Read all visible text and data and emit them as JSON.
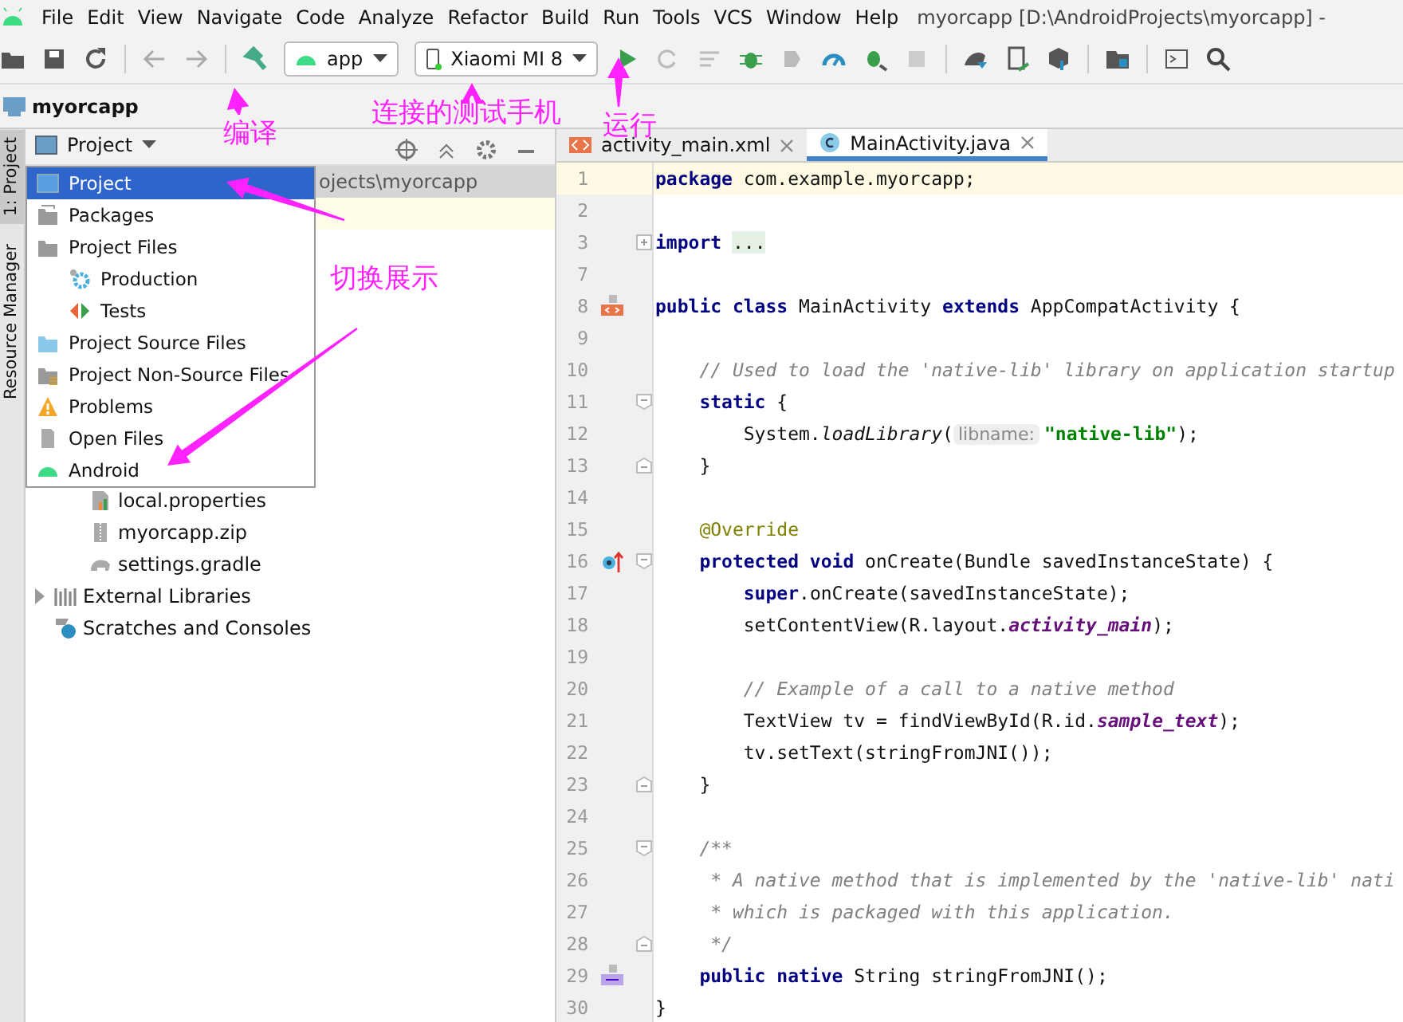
{
  "window": {
    "title": "myorcapp [D:\\AndroidProjects\\myorcapp] -"
  },
  "menu": [
    "File",
    "Edit",
    "View",
    "Navigate",
    "Code",
    "Analyze",
    "Refactor",
    "Build",
    "Run",
    "Tools",
    "VCS",
    "Window",
    "Help"
  ],
  "toolbar": {
    "run_config": "app",
    "device": "Xiaomi MI 8"
  },
  "breadcrumb": "myorcapp",
  "side_tabs": [
    {
      "label": "1: Project",
      "selected": true
    },
    {
      "label": "Resource Manager",
      "selected": false
    }
  ],
  "project_panel": {
    "view_selector": "Project",
    "view_menu": [
      {
        "label": "Project",
        "kind": "project",
        "selected": true
      },
      {
        "label": "Packages",
        "kind": "packages",
        "selected": false
      },
      {
        "label": "Project Files",
        "kind": "folder",
        "selected": false,
        "children": [
          {
            "label": "Production",
            "kind": "production",
            "selected": false
          },
          {
            "label": "Tests",
            "kind": "tests",
            "selected": false
          }
        ]
      },
      {
        "label": "Project Source Files",
        "kind": "source",
        "selected": false
      },
      {
        "label": "Project Non-Source Files",
        "kind": "nonsource",
        "selected": false
      },
      {
        "label": "Problems",
        "kind": "problems",
        "selected": false
      },
      {
        "label": "Open Files",
        "kind": "openfiles",
        "selected": false
      },
      {
        "label": "Android",
        "kind": "android",
        "selected": false
      }
    ],
    "tree": [
      {
        "label": "ojects\\myorcapp",
        "selected": true,
        "expanded": true,
        "children": [
          {
            "label": "local.properties",
            "kind": "properties"
          },
          {
            "label": "myorcapp.zip",
            "kind": "zip"
          },
          {
            "label": "settings.gradle",
            "kind": "gradle"
          }
        ]
      },
      {
        "label": "External Libraries",
        "kind": "libraries",
        "expanded": false
      },
      {
        "label": "Scratches and Consoles",
        "kind": "scratches"
      }
    ]
  },
  "editor": {
    "tabs": [
      {
        "label": "activity_main.xml",
        "kind": "xml",
        "selected": false
      },
      {
        "label": "MainActivity.java",
        "kind": "java",
        "selected": true
      }
    ],
    "lines": [
      {
        "number": "1",
        "selected": true,
        "segments": [
          {
            "kind": "kw",
            "text": "package"
          },
          {
            "kind": "plain",
            "text": " com.example.myorcapp;"
          }
        ]
      },
      {
        "number": "2",
        "selected": false
      },
      {
        "number": "3",
        "selected": false,
        "fold": {
          "kind": "collapsed"
        },
        "segments": [
          {
            "kind": "kw",
            "text": "import "
          },
          {
            "kind": "folded",
            "text": "..."
          }
        ]
      },
      {
        "number": "7",
        "selected": false
      },
      {
        "number": "8",
        "selected": false,
        "marker": {
          "kind": "xml"
        },
        "segments": [
          {
            "kind": "kw",
            "text": "public class"
          },
          {
            "kind": "plain",
            "text": " MainActivity "
          },
          {
            "kind": "kw",
            "text": "extends"
          },
          {
            "kind": "plain",
            "text": " AppCompatActivity {"
          }
        ]
      },
      {
        "number": "9",
        "selected": false
      },
      {
        "number": "10",
        "selected": false,
        "segments": [
          {
            "kind": "comment",
            "text": "    // Used to load the 'native-lib' library on application startup"
          }
        ]
      },
      {
        "number": "11",
        "selected": false,
        "fold": {
          "kind": "expanded"
        },
        "segments": [
          {
            "kind": "kw",
            "text": "    static"
          },
          {
            "kind": "plain",
            "text": " {"
          }
        ]
      },
      {
        "number": "12",
        "selected": false,
        "segments": [
          {
            "kind": "plain",
            "text": "        System."
          },
          {
            "kind": "method",
            "text": "loadLibrary"
          },
          {
            "kind": "plain",
            "text": "("
          },
          {
            "kind": "hint",
            "text": "libname:"
          },
          {
            "kind": "str",
            "text": "\"native-lib\""
          },
          {
            "kind": "plain",
            "text": ");"
          }
        ]
      },
      {
        "number": "13",
        "selected": false,
        "fold": {
          "kind": "end"
        },
        "segments": [
          {
            "kind": "plain",
            "text": "    }"
          }
        ]
      },
      {
        "number": "14",
        "selected": false
      },
      {
        "number": "15",
        "selected": false,
        "segments": [
          {
            "kind": "ann",
            "text": "    @Override"
          }
        ]
      },
      {
        "number": "16",
        "selected": false,
        "marker": {
          "kind": "override"
        },
        "fold": {
          "kind": "expanded"
        },
        "segments": [
          {
            "kind": "kw",
            "text": "    protected void"
          },
          {
            "kind": "plain",
            "text": " onCreate(Bundle savedInstanceState) {"
          }
        ]
      },
      {
        "number": "17",
        "selected": false,
        "segments": [
          {
            "kind": "kw",
            "text": "        super"
          },
          {
            "kind": "plain",
            "text": ".onCreate(savedInstanceState);"
          }
        ]
      },
      {
        "number": "18",
        "selected": false,
        "segments": [
          {
            "kind": "plain",
            "text": "        setContentView(R.layout."
          },
          {
            "kind": "field",
            "text": "activity_main"
          },
          {
            "kind": "plain",
            "text": ");"
          }
        ]
      },
      {
        "number": "19",
        "selected": false
      },
      {
        "number": "20",
        "selected": false,
        "segments": [
          {
            "kind": "comment",
            "text": "        // Example of a call to a native method"
          }
        ]
      },
      {
        "number": "21",
        "selected": false,
        "segments": [
          {
            "kind": "plain",
            "text": "        TextView tv = findViewById(R.id."
          },
          {
            "kind": "field",
            "text": "sample_text"
          },
          {
            "kind": "plain",
            "text": ");"
          }
        ]
      },
      {
        "number": "22",
        "selected": false,
        "segments": [
          {
            "kind": "plain",
            "text": "        tv.setText(stringFromJNI());"
          }
        ]
      },
      {
        "number": "23",
        "selected": false,
        "fold": {
          "kind": "end"
        },
        "segments": [
          {
            "kind": "plain",
            "text": "    }"
          }
        ]
      },
      {
        "number": "24",
        "selected": false
      },
      {
        "number": "25",
        "selected": false,
        "fold": {
          "kind": "expanded"
        },
        "segments": [
          {
            "kind": "comment",
            "text": "    /**"
          }
        ]
      },
      {
        "number": "26",
        "selected": false,
        "segments": [
          {
            "kind": "comment",
            "text": "     * A native method that is implemented by the 'native-lib' nati"
          }
        ]
      },
      {
        "number": "27",
        "selected": false,
        "segments": [
          {
            "kind": "comment",
            "text": "     * which is packaged with this application."
          }
        ]
      },
      {
        "number": "28",
        "selected": false,
        "fold": {
          "kind": "end"
        },
        "segments": [
          {
            "kind": "comment",
            "text": "     */"
          }
        ]
      },
      {
        "number": "29",
        "selected": false,
        "marker": {
          "kind": "cpp"
        },
        "segments": [
          {
            "kind": "kw",
            "text": "    public native"
          },
          {
            "kind": "plain",
            "text": " String stringFromJNI();"
          }
        ]
      },
      {
        "number": "30",
        "selected": false,
        "segments": [
          {
            "kind": "plain",
            "text": "}"
          }
        ]
      }
    ]
  },
  "annotations": [
    {
      "text": "编译"
    },
    {
      "text": "连接的测试手机"
    },
    {
      "text": "运行"
    },
    {
      "text": "切换展示"
    }
  ]
}
